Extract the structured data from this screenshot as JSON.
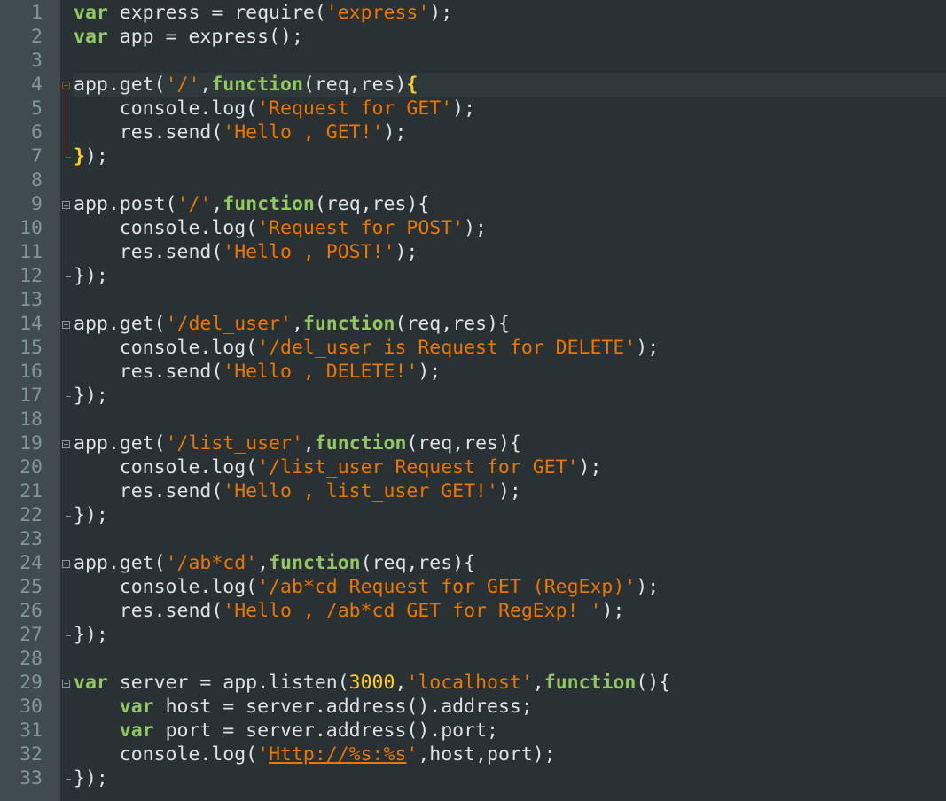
{
  "editor": {
    "current_line": 4,
    "colors": {
      "background": "#293134",
      "gutter": "#3f4b4e",
      "line_number": "#81969a",
      "keyword": "#93c763",
      "string": "#ec7600",
      "number": "#ffcd22",
      "text": "#e0e2e4",
      "active_fold": "#c0392b"
    },
    "lines": [
      {
        "n": "1",
        "tokens": [
          {
            "t": "kw",
            "v": "var"
          },
          {
            "t": "plain",
            "v": " express = require("
          },
          {
            "t": "str",
            "v": "'express'"
          },
          {
            "t": "plain",
            "v": ");"
          }
        ]
      },
      {
        "n": "2",
        "tokens": [
          {
            "t": "kw",
            "v": "var"
          },
          {
            "t": "plain",
            "v": " app = express();"
          }
        ]
      },
      {
        "n": "3",
        "tokens": []
      },
      {
        "n": "4",
        "tokens": [
          {
            "t": "plain",
            "v": "app.get("
          },
          {
            "t": "str",
            "v": "'/'"
          },
          {
            "t": "plain",
            "v": ","
          },
          {
            "t": "kw",
            "v": "function"
          },
          {
            "t": "plain",
            "v": "(req,res)"
          },
          {
            "t": "brace",
            "v": "{"
          }
        ]
      },
      {
        "n": "5",
        "tokens": [
          {
            "t": "plain",
            "v": "    console.log("
          },
          {
            "t": "str",
            "v": "'Request for GET'"
          },
          {
            "t": "plain",
            "v": ");"
          }
        ]
      },
      {
        "n": "6",
        "tokens": [
          {
            "t": "plain",
            "v": "    res.send("
          },
          {
            "t": "str",
            "v": "'Hello , GET!'"
          },
          {
            "t": "plain",
            "v": ");"
          }
        ]
      },
      {
        "n": "7",
        "tokens": [
          {
            "t": "brace",
            "v": "}"
          },
          {
            "t": "plain",
            "v": ");"
          }
        ]
      },
      {
        "n": "8",
        "tokens": []
      },
      {
        "n": "9",
        "tokens": [
          {
            "t": "plain",
            "v": "app.post("
          },
          {
            "t": "str",
            "v": "'/'"
          },
          {
            "t": "plain",
            "v": ","
          },
          {
            "t": "kw",
            "v": "function"
          },
          {
            "t": "plain",
            "v": "(req,res){"
          }
        ]
      },
      {
        "n": "10",
        "tokens": [
          {
            "t": "plain",
            "v": "    console.log("
          },
          {
            "t": "str",
            "v": "'Request for POST'"
          },
          {
            "t": "plain",
            "v": ");"
          }
        ]
      },
      {
        "n": "11",
        "tokens": [
          {
            "t": "plain",
            "v": "    res.send("
          },
          {
            "t": "str",
            "v": "'Hello , POST!'"
          },
          {
            "t": "plain",
            "v": ");"
          }
        ]
      },
      {
        "n": "12",
        "tokens": [
          {
            "t": "plain",
            "v": "});"
          }
        ]
      },
      {
        "n": "13",
        "tokens": []
      },
      {
        "n": "14",
        "tokens": [
          {
            "t": "plain",
            "v": "app.get("
          },
          {
            "t": "str",
            "v": "'/del_user'"
          },
          {
            "t": "plain",
            "v": ","
          },
          {
            "t": "kw",
            "v": "function"
          },
          {
            "t": "plain",
            "v": "(req,res){"
          }
        ]
      },
      {
        "n": "15",
        "tokens": [
          {
            "t": "plain",
            "v": "    console.log("
          },
          {
            "t": "str",
            "v": "'/del_user is Request for DELETE'"
          },
          {
            "t": "plain",
            "v": ");"
          }
        ]
      },
      {
        "n": "16",
        "tokens": [
          {
            "t": "plain",
            "v": "    res.send("
          },
          {
            "t": "str",
            "v": "'Hello , DELETE!'"
          },
          {
            "t": "plain",
            "v": ");"
          }
        ]
      },
      {
        "n": "17",
        "tokens": [
          {
            "t": "plain",
            "v": "});"
          }
        ]
      },
      {
        "n": "18",
        "tokens": []
      },
      {
        "n": "19",
        "tokens": [
          {
            "t": "plain",
            "v": "app.get("
          },
          {
            "t": "str",
            "v": "'/list_user'"
          },
          {
            "t": "plain",
            "v": ","
          },
          {
            "t": "kw",
            "v": "function"
          },
          {
            "t": "plain",
            "v": "(req,res){"
          }
        ]
      },
      {
        "n": "20",
        "tokens": [
          {
            "t": "plain",
            "v": "    console.log("
          },
          {
            "t": "str",
            "v": "'/list_user Request for GET'"
          },
          {
            "t": "plain",
            "v": ");"
          }
        ]
      },
      {
        "n": "21",
        "tokens": [
          {
            "t": "plain",
            "v": "    res.send("
          },
          {
            "t": "str",
            "v": "'Hello , list_user GET!'"
          },
          {
            "t": "plain",
            "v": ");"
          }
        ]
      },
      {
        "n": "22",
        "tokens": [
          {
            "t": "plain",
            "v": "});"
          }
        ]
      },
      {
        "n": "23",
        "tokens": []
      },
      {
        "n": "24",
        "tokens": [
          {
            "t": "plain",
            "v": "app.get("
          },
          {
            "t": "str",
            "v": "'/ab*cd'"
          },
          {
            "t": "plain",
            "v": ","
          },
          {
            "t": "kw",
            "v": "function"
          },
          {
            "t": "plain",
            "v": "(req,res){"
          }
        ]
      },
      {
        "n": "25",
        "tokens": [
          {
            "t": "plain",
            "v": "    console.log("
          },
          {
            "t": "str",
            "v": "'/ab*cd Request for GET (RegExp)'"
          },
          {
            "t": "plain",
            "v": ");"
          }
        ]
      },
      {
        "n": "26",
        "tokens": [
          {
            "t": "plain",
            "v": "    res.send("
          },
          {
            "t": "str",
            "v": "'Hello , /ab*cd GET for RegExp! '"
          },
          {
            "t": "plain",
            "v": ");"
          }
        ]
      },
      {
        "n": "27",
        "tokens": [
          {
            "t": "plain",
            "v": "});"
          }
        ]
      },
      {
        "n": "28",
        "tokens": []
      },
      {
        "n": "29",
        "tokens": [
          {
            "t": "kw",
            "v": "var"
          },
          {
            "t": "plain",
            "v": " server = app.listen("
          },
          {
            "t": "num",
            "v": "3000"
          },
          {
            "t": "plain",
            "v": ","
          },
          {
            "t": "str",
            "v": "'localhost'"
          },
          {
            "t": "plain",
            "v": ","
          },
          {
            "t": "kw",
            "v": "function"
          },
          {
            "t": "plain",
            "v": "(){"
          }
        ]
      },
      {
        "n": "30",
        "tokens": [
          {
            "t": "plain",
            "v": "    "
          },
          {
            "t": "kw",
            "v": "var"
          },
          {
            "t": "plain",
            "v": " host = server.address().address;"
          }
        ]
      },
      {
        "n": "31",
        "tokens": [
          {
            "t": "plain",
            "v": "    "
          },
          {
            "t": "kw",
            "v": "var"
          },
          {
            "t": "plain",
            "v": " port = server.address().port;"
          }
        ]
      },
      {
        "n": "32",
        "tokens": [
          {
            "t": "plain",
            "v": "    console.log("
          },
          {
            "t": "str",
            "v": "'"
          },
          {
            "t": "url",
            "v": "Http://%s:%s"
          },
          {
            "t": "str",
            "v": "'"
          },
          {
            "t": "plain",
            "v": ",host,port);"
          }
        ]
      },
      {
        "n": "33",
        "tokens": [
          {
            "t": "plain",
            "v": "});"
          }
        ]
      }
    ],
    "folds": [
      {
        "start": 4,
        "end": 7,
        "active": true
      },
      {
        "start": 9,
        "end": 12,
        "active": false
      },
      {
        "start": 14,
        "end": 17,
        "active": false
      },
      {
        "start": 19,
        "end": 22,
        "active": false
      },
      {
        "start": 24,
        "end": 27,
        "active": false
      },
      {
        "start": 29,
        "end": 33,
        "active": false
      }
    ]
  }
}
